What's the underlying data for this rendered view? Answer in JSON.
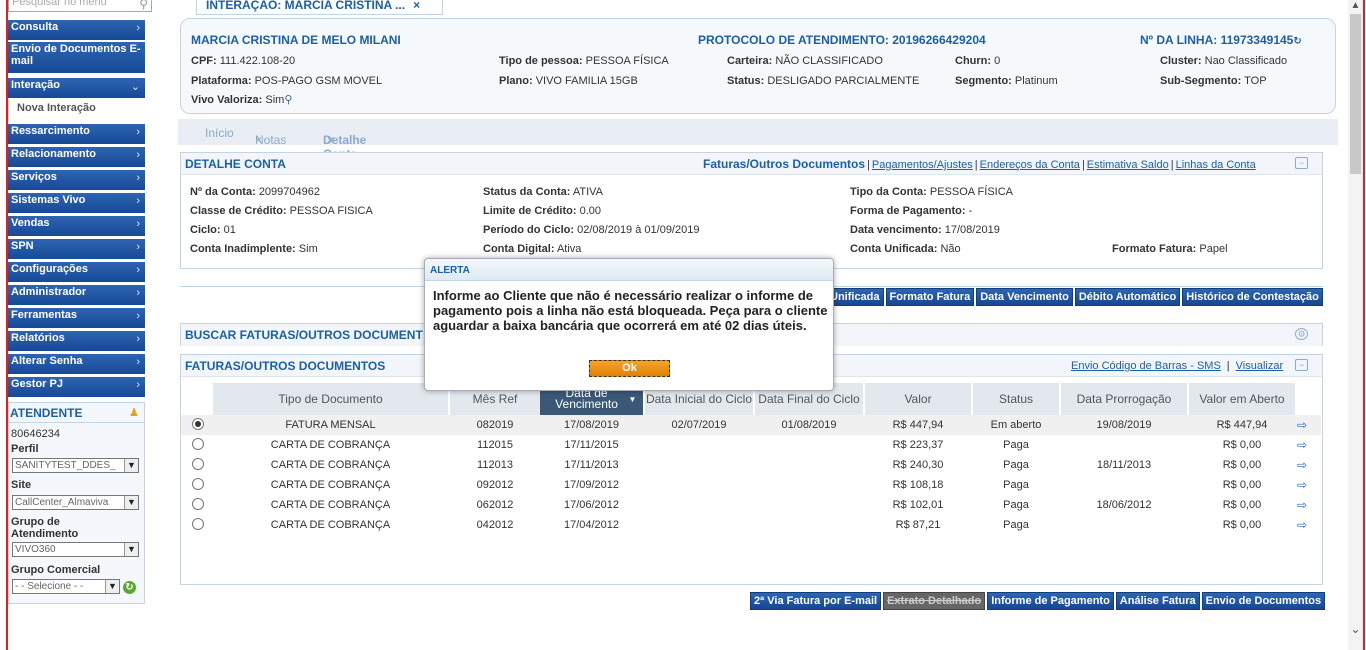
{
  "sidebar": {
    "search_placeholder": "Pesquisar no menu",
    "items": [
      {
        "label": "Consulta"
      },
      {
        "label": "Envio de Documentos E-mail"
      },
      {
        "label": "Interação"
      },
      {
        "label": "Ressarcimento"
      },
      {
        "label": "Relacionamento"
      },
      {
        "label": "Serviços"
      },
      {
        "label": "Sistemas Vivo"
      },
      {
        "label": "Vendas"
      },
      {
        "label": "SPN"
      },
      {
        "label": "Configurações"
      },
      {
        "label": "Administrador"
      },
      {
        "label": "Ferramentas"
      },
      {
        "label": "Relatórios"
      },
      {
        "label": "Alterar Senha"
      },
      {
        "label": "Gestor PJ"
      }
    ],
    "sub_item": "Nova Interação",
    "atendente": {
      "title": "ATENDENTE",
      "id": "80646234",
      "perfil_label": "Perfil",
      "perfil_value": "SANITYTEST_DDES_",
      "site_label": "Site",
      "site_value": "CallCenter_Almaviva",
      "grupo_label": "Grupo de Atendimento",
      "grupo_value": "VIVO360",
      "comercial_label": "Grupo Comercial",
      "comercial_value": "- - Selecione - -"
    }
  },
  "top_tab": {
    "label": "INTERAÇÃO: MARCIA CRISTINA ...",
    "close": "×"
  },
  "customer": {
    "name": "MARCIA CRISTINA DE MELO MILANI",
    "protocolo": "PROTOCOLO DE ATENDIMENTO: 20196266429204",
    "linha": "Nº DA LINHA: 11973349145",
    "fields": [
      {
        "label": "CPF:",
        "value": "111.422.108-20"
      },
      {
        "label": "Tipo de pessoa:",
        "value": "PESSOA FÍSICA"
      },
      {
        "label": "Carteira:",
        "value": "NÃO CLASSIFICADO"
      },
      {
        "label": "Churn:",
        "value": "0"
      },
      {
        "label": "Cluster:",
        "value": "Nao Classificado"
      },
      {
        "label": "Plataforma:",
        "value": "POS-PAGO GSM MOVEL"
      },
      {
        "label": "Plano:",
        "value": "VIVO FAMILIA 15GB"
      },
      {
        "label": "Status:",
        "value": "DESLIGADO PARCIALMENTE"
      },
      {
        "label": "Segmento:",
        "value": "Platinum"
      },
      {
        "label": "Sub-Segmento:",
        "value": "TOP"
      },
      {
        "label": "Vivo Valoriza:",
        "value": "Sim"
      }
    ]
  },
  "nav_tabs": {
    "inicio": "Início",
    "notas": "Notas",
    "detalhe": "Detalhe Conta",
    "close": "×"
  },
  "detalhe": {
    "title": "DETALHE CONTA",
    "links": {
      "faturas": "Faturas/Outros Documentos",
      "pagamentos": "Pagamentos/Ajustes",
      "enderecos": "Endereços da Conta",
      "estimativa": "Estimativa Saldo",
      "linhas": "Linhas da Conta"
    },
    "fields": [
      {
        "label": "Nº da Conta:",
        "value": "2099704962"
      },
      {
        "label": "Status da Conta:",
        "value": "ATIVA"
      },
      {
        "label": "Tipo da Conta:",
        "value": "PESSOA FÍSICA"
      },
      {
        "label": "Classe de Crédito:",
        "value": "PESSOA FISICA"
      },
      {
        "label": "Limite de Crédito:",
        "value": "0.00"
      },
      {
        "label": "Forma de Pagamento:",
        "value": "-"
      },
      {
        "label": "Ciclo:",
        "value": "01"
      },
      {
        "label": "Período do Ciclo:",
        "value": "02/08/2019 à 01/09/2019"
      },
      {
        "label": "Data vencimento:",
        "value": "17/08/2019"
      },
      {
        "label": "Conta Inadimplente:",
        "value": "Sim"
      },
      {
        "label": "Conta Digital:",
        "value": "Ativa"
      },
      {
        "label": "Conta Unificada:",
        "value": "Não"
      },
      {
        "label": "Formato Fatura:",
        "value": "Papel"
      }
    ],
    "buttons": [
      "Unificada",
      "Formato Fatura",
      "Data Vencimento",
      "Débito Automático",
      "Histórico de Contestação"
    ]
  },
  "buscar": {
    "title": "BUSCAR FATURAS/OUTROS DOCUMENT"
  },
  "faturas": {
    "title": "FATURAS/OUTROS DOCUMENTOS",
    "link_sms": "Envio Código de Barras - SMS",
    "link_vis": "Visualizar",
    "columns": [
      "Tipo de Documento",
      "Mês Ref",
      "Data de Vencimento",
      "Data Inicial do Ciclo",
      "Data Final do Ciclo",
      "Valor",
      "Status",
      "Data Prorrogação",
      "Valor em Aberto"
    ],
    "rows": [
      [
        "FATURA MENSAL",
        "082019",
        "17/08/2019",
        "02/07/2019",
        "01/08/2019",
        "R$ 447,94",
        "Em aberto",
        "19/08/2019",
        "R$ 447,94"
      ],
      [
        "CARTA DE COBRANÇA",
        "112015",
        "17/11/2015",
        "",
        "",
        "R$ 223,37",
        "Paga",
        "",
        "R$ 0,00"
      ],
      [
        "CARTA DE COBRANÇA",
        "112013",
        "17/11/2013",
        "",
        "",
        "R$ 240,30",
        "Paga",
        "18/11/2013",
        "R$ 0,00"
      ],
      [
        "CARTA DE COBRANÇA",
        "092012",
        "17/09/2012",
        "",
        "",
        "R$ 108,18",
        "Paga",
        "",
        "R$ 0,00"
      ],
      [
        "CARTA DE COBRANÇA",
        "062012",
        "17/06/2012",
        "",
        "",
        "R$ 102,01",
        "Paga",
        "18/06/2012",
        "R$ 0,00"
      ],
      [
        "CARTA DE COBRANÇA",
        "042012",
        "17/04/2012",
        "",
        "",
        "R$ 87,21",
        "Paga",
        "",
        "R$ 0,00"
      ]
    ],
    "selected_row": 0
  },
  "bottom_buttons": {
    "via": "2ª Via Fatura por E-mail",
    "extrato": "Extrato Detalhado",
    "informe": "Informe de Pagamento",
    "analise": "Análise Fatura",
    "envio": "Envio de Documentos"
  },
  "dialog": {
    "title": "ALERTA",
    "message": "Informe ao Cliente que não é necessário realizar o informe de pagamento pois a linha não está bloqueada. Peça para o cliente aguardar a baixa bancária que ocorrerá em até 02 dias úteis.",
    "ok": "Ok"
  }
}
